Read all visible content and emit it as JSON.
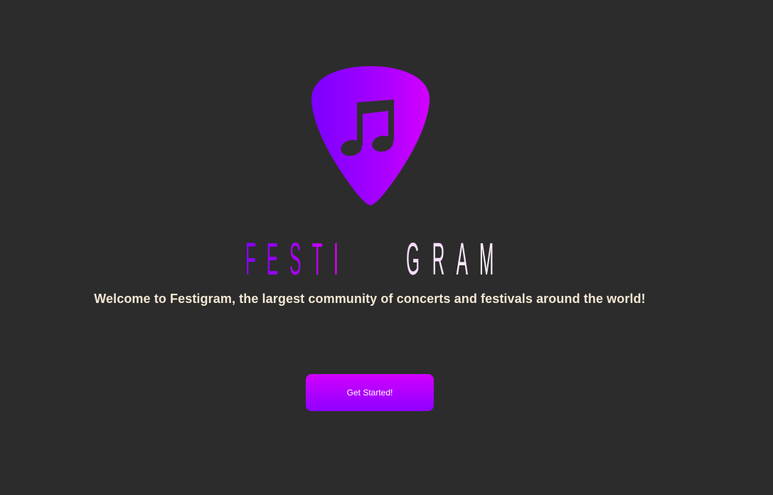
{
  "brand": {
    "wordmark_part1": "FESTI",
    "wordmark_part2": "GRAM",
    "logo_icon": "guitar-pick-music-note",
    "colors": {
      "background": "#2c2c2c",
      "purple": "#8a00ff",
      "magenta": "#e000ff",
      "pale_pink": "#f7dcf9",
      "cream_text": "#f3e7d3"
    }
  },
  "hero": {
    "welcome_text": "Welcome to Festigram, the largest community of concerts and festivals around the world!"
  },
  "cta": {
    "label": "Get Started!"
  }
}
